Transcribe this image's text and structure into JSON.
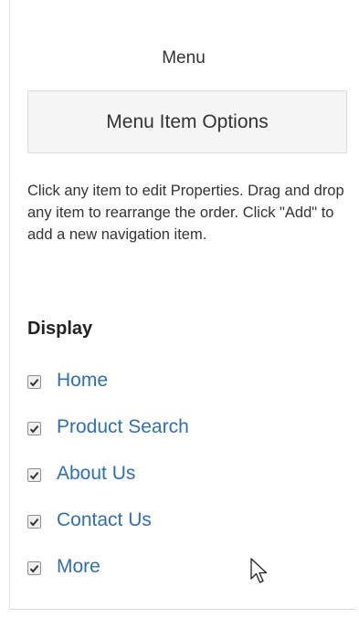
{
  "panel": {
    "title": "Menu",
    "options_button_label": "Menu Item Options",
    "help_text": "Click any item to edit Properties. Drag and drop any item to rearrange the order. Click \"Add\" to add a new navigation item.",
    "display_heading": "Display"
  },
  "menu_items": [
    {
      "label": "Home",
      "checked": true
    },
    {
      "label": "Product Search",
      "checked": true
    },
    {
      "label": "About Us",
      "checked": true
    },
    {
      "label": "Contact Us",
      "checked": true
    },
    {
      "label": "More",
      "checked": true
    }
  ],
  "colors": {
    "link": "#2f6fb3",
    "button_bg": "#f5f5f5",
    "text": "#333333"
  },
  "icons": {
    "checkbox_mark": "checkmark-icon",
    "pointer": "mouse-pointer-icon"
  }
}
